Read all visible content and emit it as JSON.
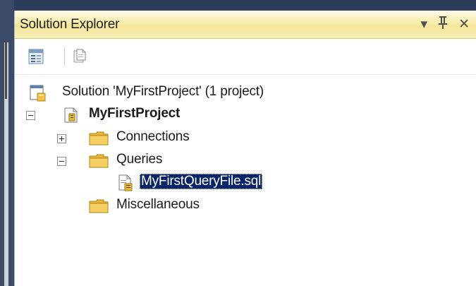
{
  "panel": {
    "title": "Solution Explorer",
    "controls": {
      "dropdown": "▾",
      "pin": "ᛘ",
      "close": "✕"
    }
  },
  "toolbar": {
    "items": [
      {
        "name": "properties",
        "icon": "properties-icon"
      },
      {
        "name": "show-all-files",
        "icon": "show-all-files-icon"
      }
    ]
  },
  "tree": {
    "solution": {
      "label": "Solution 'MyFirstProject' (1 project)",
      "icon": "solution-icon"
    },
    "project": {
      "label": "MyFirstProject",
      "icon": "project-icon",
      "expanded": true
    },
    "connections": {
      "label": "Connections",
      "icon": "folder-icon",
      "expanded": false
    },
    "queries": {
      "label": "Queries",
      "icon": "folder-icon",
      "expanded": true
    },
    "query_file": {
      "label": "MyFirstQueryFile.sql",
      "icon": "sql-file-icon",
      "selected": true
    },
    "miscellaneous": {
      "label": "Miscellaneous",
      "icon": "folder-icon"
    }
  },
  "colors": {
    "title_bar": "#f7eca8",
    "selection": "#0a246a",
    "folder": "#f2c65a"
  }
}
